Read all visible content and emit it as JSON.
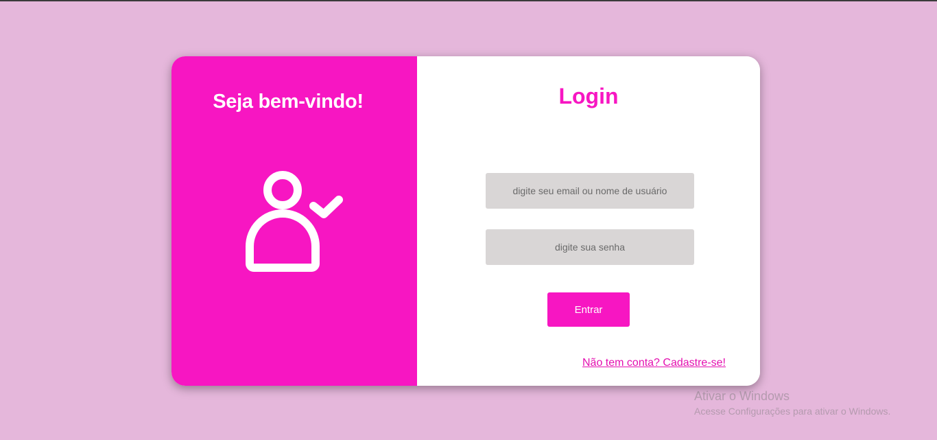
{
  "welcome": {
    "title": "Seja bem-vindo!",
    "icon": "user-check-icon"
  },
  "login": {
    "title": "Login",
    "email_placeholder": "digite seu email ou nome de usuário",
    "password_placeholder": "digite sua senha",
    "submit_label": "Entrar",
    "signup_link": "Não tem conta? Cadastre-se!"
  },
  "watermark": {
    "title": "Ativar o Windows",
    "subtitle": "Acesse Configurações para ativar o Windows."
  },
  "colors": {
    "page_background": "#e5b7db",
    "accent": "#f716c2",
    "input_background": "#d9d6d6",
    "card_background": "#ffffff"
  }
}
